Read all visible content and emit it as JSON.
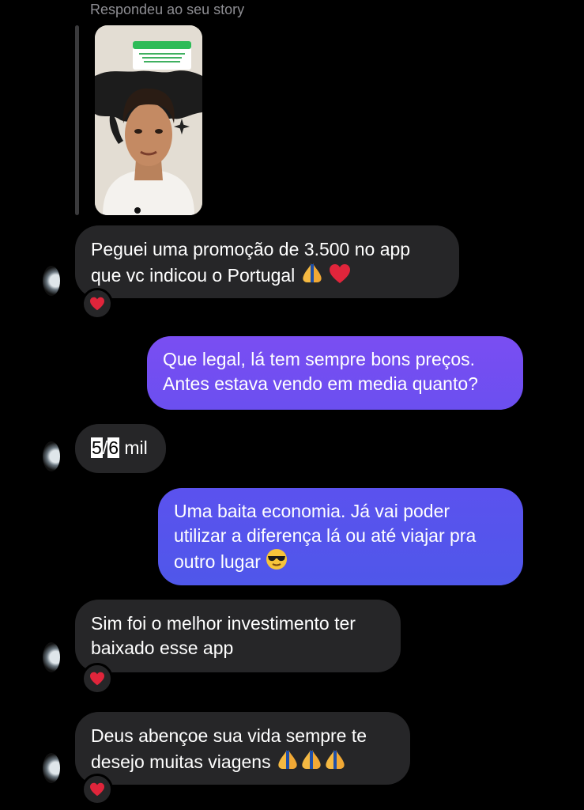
{
  "reply_caption": "Respondeu ao seu story",
  "messages": [
    {
      "text": "Peguei uma promoção de 3.500 no app\nque vc indicou o Portugal",
      "reaction": "heart-icon"
    },
    {
      "text": "Que legal, lá tem sempre bons preços.\nAntes estava vendo em media quanto?"
    },
    {
      "text_a": "5",
      "text_b": "/",
      "text_c": "6",
      "text_d": " mil"
    },
    {
      "text": "Uma baita economia. Já vai poder\nutilizar a diferença lá ou até viajar pra\noutro lugar"
    },
    {
      "text": "Sim foi o melhor investimento ter\nbaixado esse app",
      "reaction": "heart-icon"
    },
    {
      "text": "Deus abençoe sua vida sempre te\ndesejo muitas viagens",
      "reaction": "heart-icon"
    }
  ],
  "colors": {
    "incoming_bubble": "#262628",
    "outgoing_bubble_1": "#7a4ef2",
    "outgoing_bubble_2": "#5b52ee",
    "heart": "#e0253b"
  }
}
